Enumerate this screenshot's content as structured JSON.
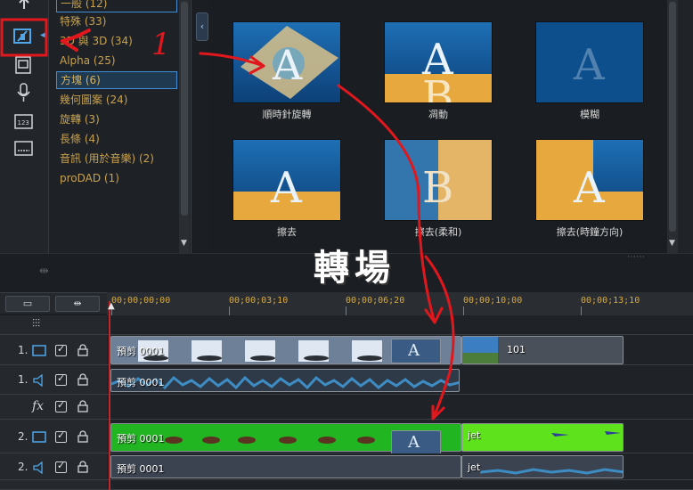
{
  "library": {
    "categories": [
      {
        "label": "一般 (12)",
        "selected": false
      },
      {
        "label": "特殊 (33)",
        "selected": false
      },
      {
        "label": "3D 與 3D (34)",
        "selected": false
      },
      {
        "label": "Alpha (25)",
        "selected": false
      },
      {
        "label": "方塊 (6)",
        "selected": true
      },
      {
        "label": "幾何圖案 (24)",
        "selected": false
      },
      {
        "label": "旋轉 (3)",
        "selected": false
      },
      {
        "label": "長條 (4)",
        "selected": false
      },
      {
        "label": "音訊 (用於音樂) (2)",
        "selected": false
      },
      {
        "label": "proDAD (1)",
        "selected": false
      }
    ],
    "collapse_glyph": "‹",
    "transitions": [
      {
        "label": "順時針旋轉",
        "letter": "A"
      },
      {
        "label": "凋動",
        "letter": "A"
      },
      {
        "label": "模糊",
        "letter": "A"
      },
      {
        "label": "擦去",
        "letter": "A"
      },
      {
        "label": "擦去(柔和)",
        "letter": "B"
      },
      {
        "label": "擦去(時鐘方向)",
        "letter": "A"
      }
    ],
    "side_icons": [
      "upload-icon",
      "transition-icon",
      "title-icon",
      "microphone-icon",
      "chapter-icon",
      "subtitle-icon"
    ]
  },
  "annotation": {
    "big_text": "轉場",
    "number": "1"
  },
  "timeline": {
    "ruler": [
      "00;00;00;00",
      "00;00;03;10",
      "00;00;06;20",
      "00;00;10;00",
      "00;00;13;10"
    ],
    "tracks": [
      {
        "num": "1.",
        "kind": "video",
        "clips": [
          {
            "name": "預剪 0001"
          },
          {
            "name": "101"
          }
        ]
      },
      {
        "num": "1.",
        "kind": "audio",
        "clips": [
          {
            "name": "預剪 0001"
          }
        ]
      },
      {
        "num": "",
        "kind": "fx",
        "label": "fx",
        "clips": []
      },
      {
        "num": "2.",
        "kind": "video",
        "clips": [
          {
            "name": "預剪 0001"
          },
          {
            "name": "jet"
          }
        ]
      },
      {
        "num": "2.",
        "kind": "audio",
        "clips": [
          {
            "name": "預剪 0001"
          },
          {
            "name": "jet"
          }
        ]
      }
    ],
    "colors": {
      "accent": "#c0272d",
      "green_clip": "#22b522",
      "timecode": "#d8a93e"
    }
  }
}
